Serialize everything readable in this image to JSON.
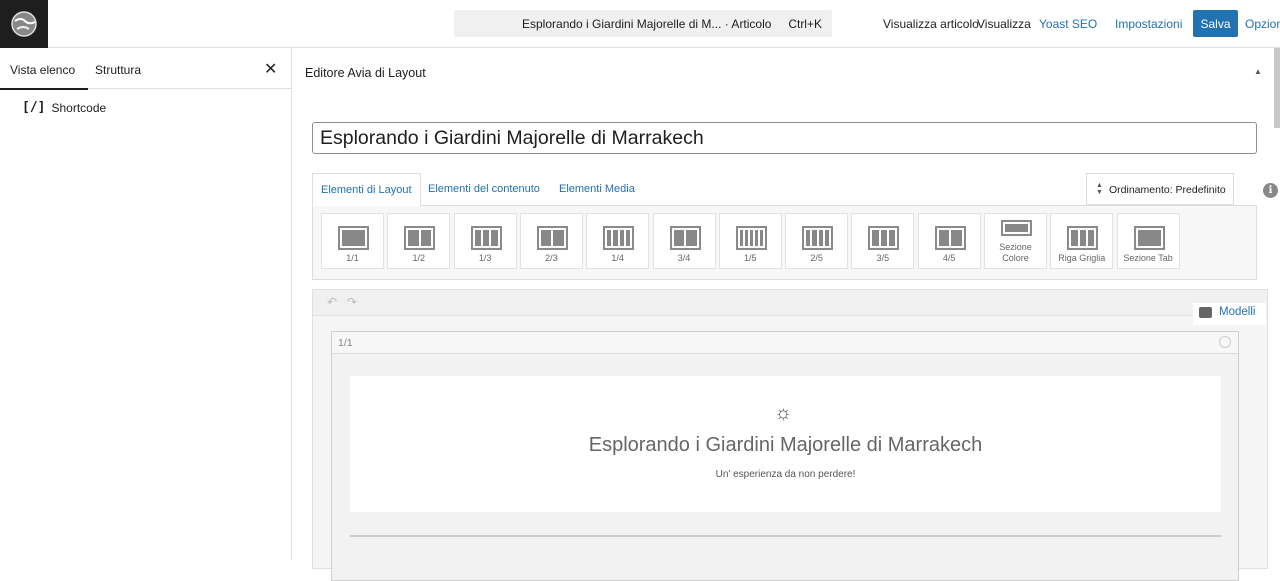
{
  "topbar": {
    "command_title": "Esplorando i Giardini Majorelle di M...",
    "command_type": "· Articolo",
    "shortcut": "Ctrl+K",
    "links": [
      "Visualizza articolo",
      "Visualizza",
      "Yoast SEO",
      "Impostazioni"
    ],
    "save_label": "Salva",
    "options_label": "Opzion"
  },
  "sidebar": {
    "tabs": [
      "Vista elenco",
      "Struttura"
    ],
    "close_label": "✕",
    "items": [
      {
        "icon": "[/]",
        "label": "Shortcode"
      }
    ]
  },
  "editor": {
    "title": "Editore Avia di Layout",
    "post_title": "Esplorando i Giardini Majorelle di Marrakech",
    "tabs": [
      "Elementi di Layout",
      "Elementi del contenuto",
      "Elementi Media"
    ],
    "sort_label": "Ordinamento: Predefinito",
    "info_label": "i",
    "elements": [
      {
        "label": "1/1",
        "cols": 1
      },
      {
        "label": "1/2",
        "cols": 2
      },
      {
        "label": "1/3",
        "cols": 3
      },
      {
        "label": "2/3",
        "cols": 2
      },
      {
        "label": "1/4",
        "cols": 4
      },
      {
        "label": "3/4",
        "cols": 2
      },
      {
        "label": "1/5",
        "cols": 5
      },
      {
        "label": "2/5",
        "cols": 4
      },
      {
        "label": "3/5",
        "cols": 3
      },
      {
        "label": "4/5",
        "cols": 2
      },
      {
        "label": "Sezione Colore",
        "cols": 1
      },
      {
        "label": "Riga Griglia",
        "cols": 3
      },
      {
        "label": "Sezione Tab",
        "cols": 1
      }
    ],
    "models_label": "Modelli",
    "column_label": "1/1",
    "card": {
      "heading": "Esplorando i Giardini Majorelle di Marrakech",
      "subheading": "Un' esperienza da non perdere!"
    }
  },
  "colors": {
    "accent": "#2271b1",
    "dark": "#1e1e1e"
  }
}
